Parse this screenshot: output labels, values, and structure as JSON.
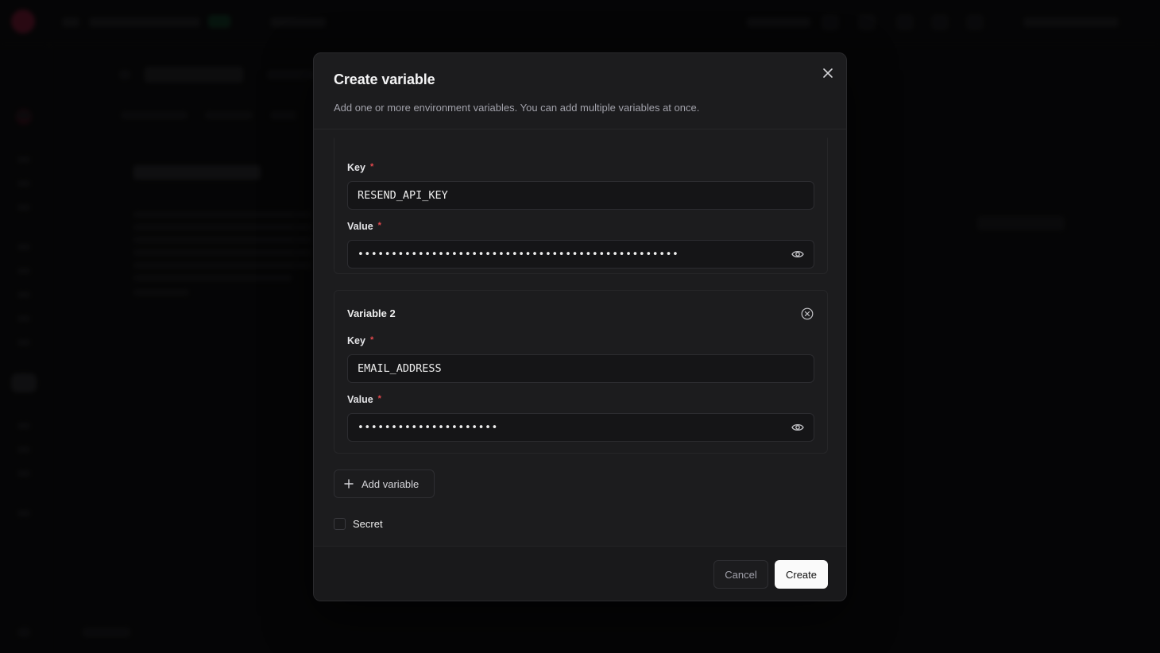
{
  "modal": {
    "title": "Create variable",
    "description": "Add one or more environment variables. You can add multiple variables at once.",
    "variables": [
      {
        "title": "",
        "key_label": "Key",
        "key_value": "RESEND_API_KEY",
        "value_label": "Value",
        "value_masked": "••••••••••••••••••••••••••••••••••••••••••••••••"
      },
      {
        "title": "Variable 2",
        "key_label": "Key",
        "key_value": "EMAIL_ADDRESS",
        "value_label": "Value",
        "value_masked": "•••••••••••••••••••••"
      }
    ],
    "required_marker": "*",
    "add_variable_label": "Add variable",
    "secret_label": "Secret",
    "secret_checked": false,
    "cancel_label": "Cancel",
    "create_label": "Create"
  },
  "icons": {
    "close": "close-icon",
    "eye": "eye-icon",
    "remove": "circle-x-icon",
    "plus": "plus-icon"
  },
  "colors": {
    "overlay": "#000000",
    "modal_bg": "#1c1c1e",
    "required": "#e5484d",
    "primary_button": "#fafafa"
  }
}
